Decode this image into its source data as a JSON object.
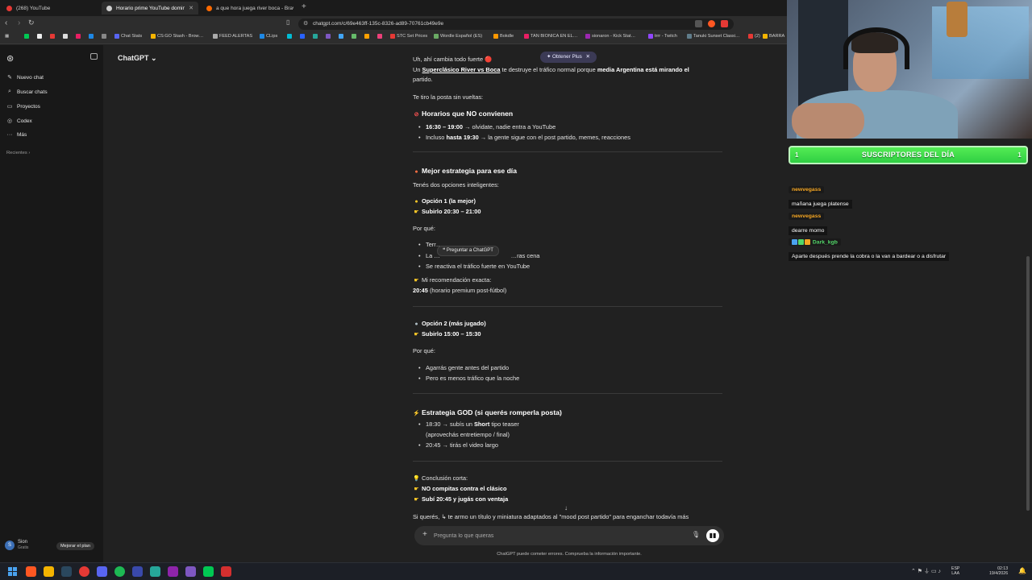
{
  "browser": {
    "tabs": [
      {
        "label": "(268) YouTube",
        "color": "#e53935"
      },
      {
        "label": "Horario prime YouTube doming…",
        "color": "#cfcfcf"
      },
      {
        "label": "a que hora juega river boca - Brave S…",
        "color": "#ff6a00"
      }
    ],
    "url": "chatgpt.com/c/69e463ff-135c-8326-ad89-70761cb49e9e",
    "bookmarks": [
      {
        "label": "Chat Stats",
        "color": "#5865f2"
      },
      {
        "label": "CS:GO Stash - Brow…",
        "color": "#f4b400"
      },
      {
        "label": "FEED ALERTAS",
        "color": "#aaaaaa"
      },
      {
        "label": "CLips",
        "color": "#1e88e5"
      },
      {
        "label": "STC Set Prices",
        "color": "#e53935"
      },
      {
        "label": "Wordle Español (ES)",
        "color": "#6aaa64"
      },
      {
        "label": "Bokdle",
        "color": "#ff9800"
      },
      {
        "label": "TAN BIONICA EN EL…",
        "color": "#e91e63"
      },
      {
        "label": "sionaron - Kick Stat…",
        "color": "#9c27b0"
      },
      {
        "label": "trrr - Twitch",
        "color": "#9146ff"
      },
      {
        "label": "Tanuki Sunset Classi…",
        "color": "#607d8b"
      },
      {
        "label": "(2)",
        "color": "#e53935"
      },
      {
        "label": "BARRA",
        "color": "#f4b400"
      }
    ]
  },
  "sidebar": {
    "items": [
      {
        "label": "Nuevo chat",
        "icon": "edit-icon"
      },
      {
        "label": "Buscar chats",
        "icon": "search-icon"
      },
      {
        "label": "Proyectos",
        "icon": "folder-icon"
      },
      {
        "label": "Codex",
        "icon": "codex-icon"
      },
      {
        "label": "Más",
        "icon": "more-icon"
      }
    ],
    "recientes": "Recientes ›",
    "user_name": "Sion",
    "user_plan": "Gratis",
    "user_initial": "S",
    "upgrade": "Mejorar el plan"
  },
  "main": {
    "model": "ChatGPT ⌄",
    "plus_pill": "Obtener Plus",
    "ask_popup": "Preguntar a ChatGPT",
    "composer_placeholder": "Pregunta lo que quieras",
    "disclaimer": "ChatGPT puede cometer errores. Comprueba la información importante."
  },
  "chat": {
    "l1": "Uh, ahí cambia todo fuerte 🔴",
    "l2a": "Un ",
    "l2b": "Superclásico River vs Boca",
    "l2c": " te destruye el tráfico normal porque ",
    "l2d": "media Argentina está mirando el",
    "l3": "partido.",
    "l4": "Te tiro la posta sin vueltas:",
    "h1": "Horarios que NO convienen",
    "b1a": "16:30 – 19:00",
    "b1b": " → olvidate, nadie entra a YouTube",
    "b2a": "Incluso ",
    "b2b": "hasta 19:30",
    "b2c": " → la gente sigue con el post partido, memes, reacciones",
    "h2": "Mejor estrategia para ese día",
    "l5": "Tenés dos opciones inteligentes:",
    "o1": "Opción 1 (la mejor)",
    "o1s": "Subirlo 20:30 – 21:00",
    "pq1": "Por qué:",
    "pb1": "Terr… ",
    "pb2": "La …",
    "pb2b": "…ras cena",
    "pb3": "Se reactiva el tráfico fuerte en YouTube",
    "rec": "Mi recomendación exacta:",
    "rec_val": "20:45",
    "rec_rest": " (horario premium post-fútbol)",
    "o2": "Opción 2 (más jugado)",
    "o2s": "Subirlo 15:00 – 15:30",
    "pq2": "Por qué:",
    "p2b1": "Agarrás gente antes del partido",
    "p2b2": "Pero es menos tráfico que la noche",
    "h3": "Estrategia GOD (si querés romperla posta)",
    "g1a": "18:30 → subís un ",
    "g1b": "Short",
    "g1c": " tipo teaser",
    "g1d": "(aprovechás entretiempo / final)",
    "g2": "20:45 → tirás el video largo",
    "c0": "Conclusión corta:",
    "c1": "NO compitas contra el clásico",
    "c2": "Subí 20:45 y jugás con ventaja",
    "last": "Si querés, ↳ te armo un título y miniatura adaptados al \"mood post partido\" para enganchar todavía más"
  },
  "overlay": {
    "subs_title": "SUSCRIPTORES DEL DÍA",
    "subs_left": "1",
    "subs_right": "1",
    "messages": [
      {
        "user": "newvegass",
        "user_color": "#f5a623",
        "text": "mañana juega platense"
      },
      {
        "user": "newvegass",
        "user_color": "#f5a623",
        "text": "dearre momo"
      },
      {
        "user": "Dark_kgb",
        "user_color": "#53d769",
        "text": "Aparte después prende la cobra o la van a bardear o a disfrutar"
      }
    ]
  },
  "taskbar": {
    "lang_1": "ESP",
    "lang_2": "LAA",
    "time": "02:13",
    "date": "19/4/2026"
  },
  "colors": {
    "accent_green": "#2fcf43",
    "chat_bg": "#212121",
    "sidebar_bg": "#181818"
  }
}
